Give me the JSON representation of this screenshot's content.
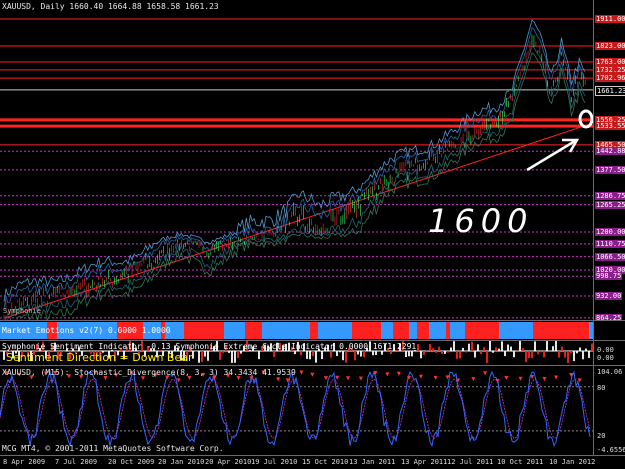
{
  "main_pane": {
    "header": "XAUUSD, Daily  1660.40 1664.88 1658.58 1661.23",
    "symbol_watermark": "Symphonie",
    "annotation_text": "1600",
    "price_levels": [
      {
        "label": "1911.00",
        "value": 1911.0,
        "color": "#ff2222"
      },
      {
        "label": "1823.00",
        "value": 1823.0,
        "color": "#ff2222"
      },
      {
        "label": "1763.00",
        "value": 1763.0,
        "color": "#ff2222"
      },
      {
        "label": "1732.25",
        "value": 1732.25,
        "color": "#ff2222"
      },
      {
        "label": "1702.96",
        "value": 1702.96,
        "color": "#ff2222"
      },
      {
        "label": "1661.23",
        "value": 1661.23,
        "color": "#cccccc"
      },
      {
        "label": "1556.25",
        "value": 1556.25,
        "color": "#ff2222"
      },
      {
        "label": "1533.55",
        "value": 1533.55,
        "color": "#ff2222"
      },
      {
        "label": "1465.50",
        "value": 1465.5,
        "color": "#ff2222"
      },
      {
        "label": "1442.88",
        "value": 1442.88,
        "color": "#cc33cc"
      },
      {
        "label": "1377.50",
        "value": 1377.5,
        "color": "#cc33cc"
      },
      {
        "label": "1286.75",
        "value": 1286.75,
        "color": "#cc33cc"
      },
      {
        "label": "1265.25",
        "value": 1265.25,
        "color": "#cc33cc"
      },
      {
        "label": "1200.00",
        "value": 1200.0,
        "color": "#cc33cc"
      },
      {
        "label": "1110.75",
        "value": 1110.75,
        "color": "#cc33cc"
      },
      {
        "label": "1066.50",
        "value": 1066.5,
        "color": "#cc33cc"
      },
      {
        "label": "1020.00",
        "value": 1020.0,
        "color": "#cc33cc"
      },
      {
        "label": "998.75",
        "value": 998.75,
        "color": "#cc33cc"
      },
      {
        "label": "932.00",
        "value": 932.0,
        "color": "#cc33cc"
      },
      {
        "label": "864.25",
        "value": 864.25,
        "color": "#cc33cc"
      }
    ]
  },
  "market_emotions": {
    "label": "Market Emotions v2(7) 0.0000 1.0000"
  },
  "sentiment": {
    "label": "Symphonie Sentiment Indicator -0.13  Symphonie Extreme Cycle Indicator 0.0000 1671.2291",
    "direction": "Sentiment Direction = Down Bear",
    "axis_top": "0.00",
    "axis_bottom": "0.00"
  },
  "stochastic": {
    "label": "XAUUSD, (M15):  Stochastic_Divergence(8, 3, 3) 34.3434 41.9539",
    "axis_labels": [
      "104.06",
      "80",
      "20",
      "-4.6556"
    ]
  },
  "footer": {
    "copyright": "MCG MT4, © 2001-2011 MetaQuotes Software Corp."
  },
  "x_axis": {
    "labels": [
      "8 Apr 2009",
      "7 Jul 2009",
      "20 Oct 2009",
      "20 Jan 2010",
      "20 Apr 2010",
      "19 Jul 2010",
      "15 Oct 2010",
      "13 Jan 2011",
      "13 Apr 2011",
      "12 Jul 2011",
      "10 Oct 2011",
      "10 Jan 2012"
    ]
  },
  "colors": {
    "background": "#000000",
    "support_line": "#ff2222",
    "resistance": "#ff2222",
    "pivot": "#cc33cc",
    "emotions_red": "#ff2020",
    "emotions_blue": "#3399ff",
    "stoch_main": "#3366ff",
    "stoch_signal": "#cc33cc",
    "arrow": "#ff3333"
  }
}
